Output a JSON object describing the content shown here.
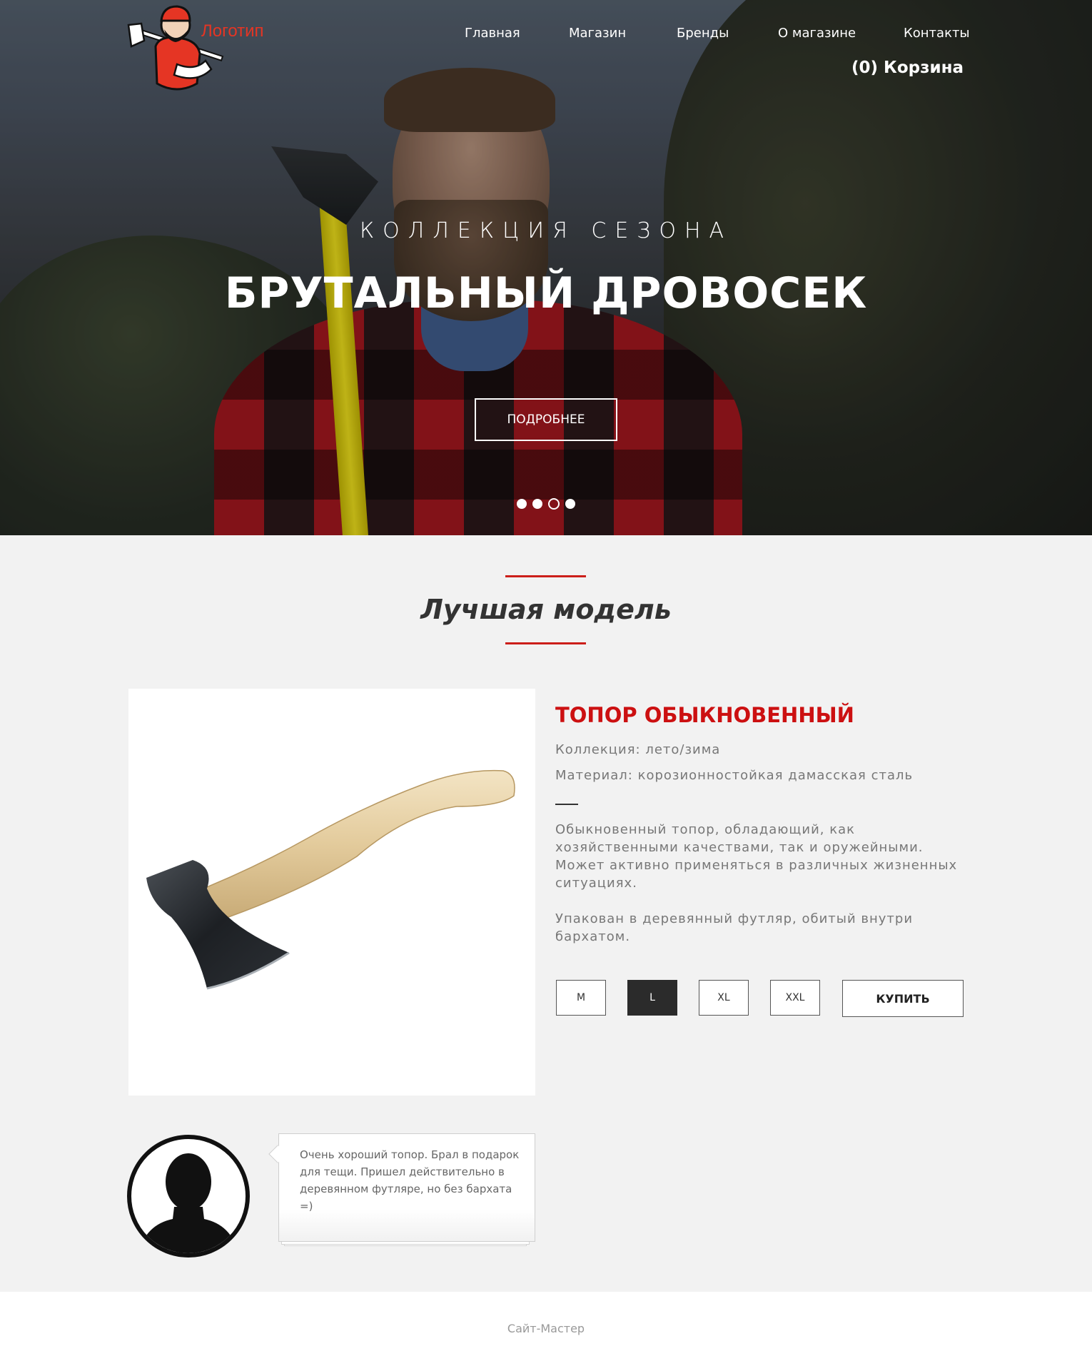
{
  "logo": {
    "text": "Логотип",
    "icon": "lumberjack-logo-icon"
  },
  "nav": {
    "items": [
      {
        "label": "Главная"
      },
      {
        "label": "Магазин"
      },
      {
        "label": "Бренды"
      },
      {
        "label": "О магазине"
      },
      {
        "label": "Контакты"
      }
    ],
    "cart_label": "(0) Корзина"
  },
  "hero": {
    "subtitle": "КОЛЛЕКЦИЯ СЕЗОНА",
    "title": "БРУТАЛЬНЫЙ ДРОВОСЕК",
    "button_label": "ПОДРОБНЕЕ",
    "slider_dots_count": 4,
    "active_dot_index": 2
  },
  "section": {
    "title": "Лучшая модель"
  },
  "product": {
    "title": "ТОПОР ОБЫКНОВЕННЫЙ",
    "collection": "Коллекция: лето/зима",
    "material": "Материал: корозионностойкая дамасская сталь",
    "description_1": "Обыкновенный топор, обладающий, как хозяйственными качествами, так и оружейными. Может активно применяться в различных жизненных ситуациях.",
    "description_2": "Упакован в деревянный футляр, обитый внутри бархатом.",
    "sizes": [
      "M",
      "L",
      "XL",
      "XXL"
    ],
    "selected_size": "L",
    "buy_label": "КУПИТЬ",
    "image_icon": "axe-product-image"
  },
  "review": {
    "text": "Очень хороший топор. Брал в подарок для тещи. Пришел действительно в деревянном футляре, но без бархата =)",
    "avatar_icon": "user-silhouette-icon"
  },
  "footer": {
    "text": "Сайт-Мастер"
  },
  "colors": {
    "accent": "#cc1011",
    "logo_red": "#e53524",
    "dark_button": "#2b2b2b",
    "page_bg": "#f2f2f2"
  }
}
